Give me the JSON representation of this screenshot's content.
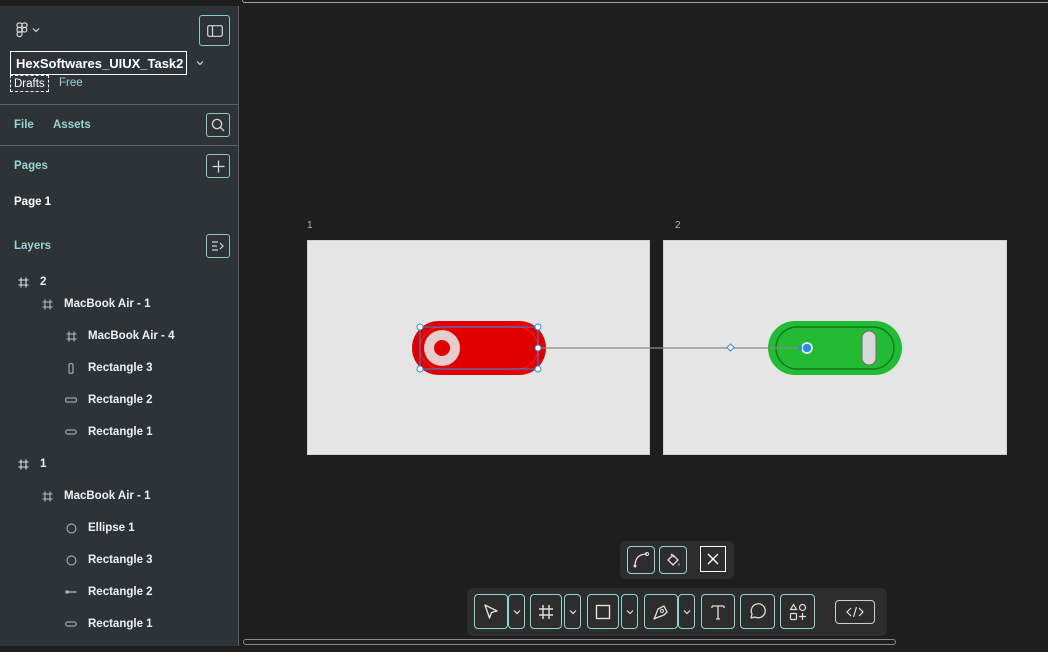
{
  "app": {
    "file_name": "HexSoftwares_UIUX_Task2",
    "drafts_label": "Drafts",
    "plan_label": "Free"
  },
  "sidebar": {
    "tabs": {
      "file": "File",
      "assets": "Assets"
    },
    "pages_title": "Pages",
    "pages": [
      "Page 1"
    ],
    "layers_title": "Layers",
    "layers": [
      {
        "name": "2",
        "icon": "frame-icon"
      },
      {
        "name": "MacBook Air - 1",
        "icon": "frame-icon"
      },
      {
        "name": "MacBook Air - 4",
        "icon": "frame-icon"
      },
      {
        "name": "Rectangle 3",
        "icon": "rectangle-vertical-icon"
      },
      {
        "name": "Rectangle 2",
        "icon": "rectangle-horizontal-icon"
      },
      {
        "name": "Rectangle 1",
        "icon": "rectangle-horizontal-icon"
      },
      {
        "name": "1",
        "icon": "frame-icon"
      },
      {
        "name": "MacBook Air - 1",
        "icon": "frame-icon"
      },
      {
        "name": "Ellipse 1",
        "icon": "ellipse-icon"
      },
      {
        "name": "Rectangle 3",
        "icon": "ellipse-icon"
      },
      {
        "name": "Rectangle 2",
        "icon": "line-icon"
      },
      {
        "name": "Rectangle 1",
        "icon": "rectangle-horizontal-icon"
      }
    ]
  },
  "canvas": {
    "frames": [
      {
        "label": "1",
        "toggle_state": "off",
        "toggle_color": "#e00000"
      },
      {
        "label": "2",
        "toggle_state": "on",
        "toggle_color": "#22bb33"
      }
    ]
  },
  "toolbar": {
    "context_tools": [
      "bend-tool-icon",
      "paint-bucket-icon",
      "close-icon"
    ],
    "tools": [
      "move-tool-icon",
      "frame-tool-icon",
      "rectangle-tool-icon",
      "pen-tool-icon",
      "text-tool-icon",
      "comment-tool-icon",
      "actions-icon",
      "dev-mode-icon"
    ]
  },
  "colors": {
    "accent": "#9ad4d2",
    "sidebar_bg": "#2e3338",
    "canvas_bg": "#1e1e1e",
    "selection": "#2e8ae6"
  }
}
